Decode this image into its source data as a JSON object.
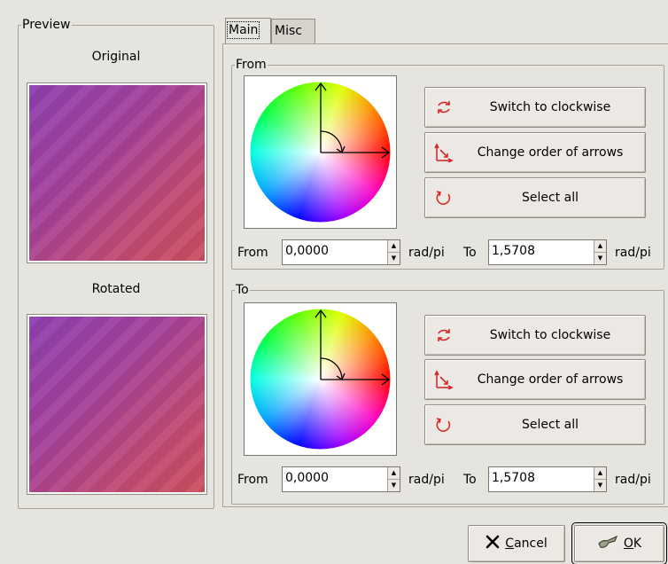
{
  "preview": {
    "legend": "Preview",
    "original_label": "Original",
    "rotated_label": "Rotated"
  },
  "tabs": [
    {
      "label": "Main",
      "active": true
    },
    {
      "label": "Misc",
      "active": false
    }
  ],
  "from_section": {
    "legend": "From",
    "buttons": {
      "switch": {
        "label": "Switch to clockwise",
        "icon": "rotate-arrows-icon"
      },
      "change_order": {
        "label": "Change order of arrows",
        "icon": "swap-arrows-icon"
      },
      "select_all": {
        "label": "Select all",
        "icon": "circle-arrow-icon"
      }
    },
    "range": {
      "from_label": "From",
      "from_value": "0,0000",
      "unit1": "rad/pi",
      "to_label": "To",
      "to_value": "1,5708",
      "unit2": "rad/pi"
    }
  },
  "to_section": {
    "legend": "To",
    "buttons": {
      "switch": {
        "label": "Switch to clockwise",
        "icon": "rotate-arrows-icon"
      },
      "change_order": {
        "label": "Change order of arrows",
        "icon": "swap-arrows-icon"
      },
      "select_all": {
        "label": "Select all",
        "icon": "circle-arrow-icon"
      }
    },
    "range": {
      "from_label": "From",
      "from_value": "0,0000",
      "unit1": "rad/pi",
      "to_label": "To",
      "to_value": "1,5708",
      "unit2": "rad/pi"
    }
  },
  "dialog_buttons": {
    "cancel": {
      "label": "Cancel",
      "mnemonic": "C",
      "rest": "ancel",
      "icon": "cancel-x-icon"
    },
    "ok": {
      "label": "OK",
      "mnemonic": "O",
      "rest": "K",
      "icon": "ok-check-icon"
    }
  },
  "colors": {
    "icon_red": "#d42a2a",
    "preview_gradient_start": "#8e3fb0",
    "preview_gradient_end": "#cc4d5e"
  }
}
